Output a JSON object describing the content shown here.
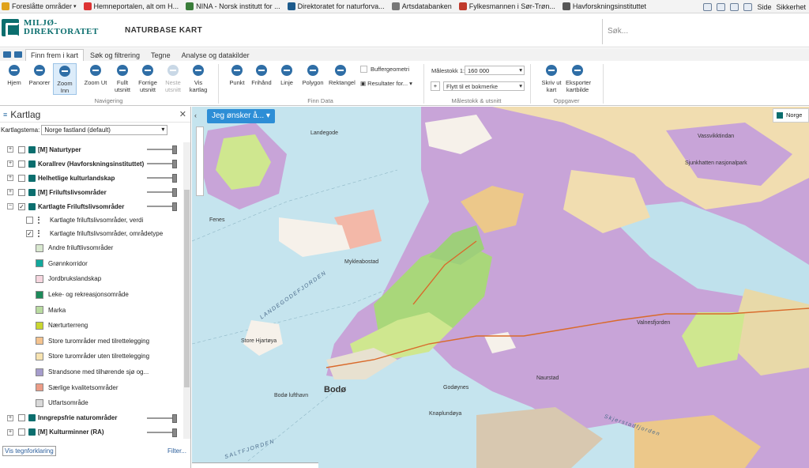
{
  "favorites": [
    {
      "label": "Foreslåtte områder",
      "color": "#e0a21b",
      "dropdown": true
    },
    {
      "label": "Hemneportalen, alt om H...",
      "color": "#d33",
      "dropdown": false
    },
    {
      "label": "NINA - Norsk institutt for ...",
      "color": "#3a7d3a",
      "dropdown": false
    },
    {
      "label": "Direktoratet for naturforva...",
      "color": "#1d5b8c",
      "dropdown": false
    },
    {
      "label": "Artsdatabanken",
      "color": "#777",
      "dropdown": false
    },
    {
      "label": "Fylkesmannen i Sør-Trøn...",
      "color": "#c0392b",
      "dropdown": false
    },
    {
      "label": "Havforskningsinstituttet",
      "color": "#555",
      "dropdown": false
    }
  ],
  "browser_menu": {
    "side": "Side",
    "sikkerhet": "Sikkerhet"
  },
  "header": {
    "logo_line1": "MILJØ-",
    "logo_line2": "DIREKTORATET",
    "app_title": "NATURBASE KART",
    "search_placeholder": "Søk..."
  },
  "tabs": [
    "Finn frem i kart",
    "Søk og filtrering",
    "Tegne",
    "Analyse og datakilder"
  ],
  "ribbon": {
    "navigation": [
      {
        "label": "Hjem",
        "icon": "home-icon",
        "enabled": true
      },
      {
        "label": "Panorer",
        "icon": "pan-icon",
        "enabled": true
      },
      {
        "label": "Zoom Inn",
        "icon": "zoom-in-icon",
        "enabled": true,
        "selected": true
      },
      {
        "label": "Zoom Ut",
        "icon": "zoom-out-icon",
        "enabled": true
      },
      {
        "label": "Fullt utsnitt",
        "icon": "full-extent-icon",
        "enabled": true
      },
      {
        "label": "Forrige utsnitt",
        "icon": "previous-extent-icon",
        "enabled": true
      },
      {
        "label": "Neste utsnitt",
        "icon": "next-extent-icon",
        "enabled": false
      },
      {
        "label": "Vis kartlag",
        "icon": "layers-icon",
        "enabled": true
      }
    ],
    "navigation_group": "Navigering",
    "find": [
      {
        "label": "Punkt",
        "icon": "point-icon"
      },
      {
        "label": "Frihånd",
        "icon": "freehand-icon"
      },
      {
        "label": "Linje",
        "icon": "line-icon"
      },
      {
        "label": "Polygon",
        "icon": "polygon-icon"
      },
      {
        "label": "Rektangel",
        "icon": "rectangle-icon"
      }
    ],
    "buffer_label": "Buffergeometri",
    "results_label": "Resultater for...",
    "find_group": "Finn Data",
    "scale_label": "Målestokk 1:",
    "scale_value": "160 000",
    "bookmark_placeholder": "Flytt til et bokmerke",
    "scale_group": "Målestokk & utsnitt",
    "tasks": [
      {
        "label": "Skriv ut kart",
        "icon": "print-icon"
      },
      {
        "label": "Eksporter kartbilde",
        "icon": "export-icon"
      }
    ],
    "tasks_group": "Oppgaver"
  },
  "sidebar": {
    "title": "Kartlag",
    "theme_label": "Kartlagstema:",
    "theme_value": "Norge fastland (default)",
    "layers_top": [
      {
        "label": "[M] Naturtyper",
        "checked": false,
        "expand": "+"
      },
      {
        "label": "Korallrev (Havforskningsinstituttet)",
        "checked": false,
        "expand": "+"
      },
      {
        "label": "Helhetlige kulturlandskap",
        "checked": false,
        "expand": "+"
      },
      {
        "label": "[M] Friluftslivsområder",
        "checked": false,
        "expand": "+"
      },
      {
        "label": "Kartlagte Friluftslivsområder",
        "checked": true,
        "expand": "−"
      }
    ],
    "sublayers": [
      {
        "label": "Kartlagte friluftslivsområder, verdi",
        "checked": false
      },
      {
        "label": "Kartlagte friluftslivsområder, områdetype",
        "checked": true
      }
    ],
    "legend": [
      {
        "label": "Andre friluftlivsområder",
        "color": "#d8e8cf"
      },
      {
        "label": "Grønnkorridor",
        "color": "#12a89c"
      },
      {
        "label": "Jordbrukslandskap",
        "color": "#f6d6df"
      },
      {
        "label": "Leke- og rekreasjonsområde",
        "color": "#1d8a5a"
      },
      {
        "label": "Marka",
        "color": "#b9dba0"
      },
      {
        "label": "Nærturterreng",
        "color": "#c9d630"
      },
      {
        "label": "Store turområder med tilrettelegging",
        "color": "#f4c38f"
      },
      {
        "label": "Store turområder uten tilrettelegging",
        "color": "#f7e3b0"
      },
      {
        "label": "Strandsone med tilhørende sjø og...",
        "color": "#a59ccc"
      },
      {
        "label": "Særlige kvalitetsområder",
        "color": "#ec9c86"
      },
      {
        "label": "Utfartsområde",
        "color": "#d9d9d9"
      }
    ],
    "layers_bottom": [
      {
        "label": "Inngrepsfrie naturområder",
        "checked": false,
        "expand": "+"
      },
      {
        "label": "[M] Kulturminner (RA)",
        "checked": false,
        "expand": "+"
      }
    ],
    "legend_button": "Vis tegnforklaring",
    "filter_link": "Filter..."
  },
  "map": {
    "action_button": "Jeg ønsker å...",
    "basemap_label": "Norge",
    "places": [
      {
        "name": "Landegode"
      },
      {
        "name": "Fenes"
      },
      {
        "name": "Bodø",
        "big": true
      },
      {
        "name": "Bodø lufthavn"
      },
      {
        "name": "Store Hjartøya"
      },
      {
        "name": "Mykleabostad"
      },
      {
        "name": "Valnesfjorden"
      },
      {
        "name": "Naurstad"
      },
      {
        "name": "Godøynes"
      },
      {
        "name": "Sjunkhatten nasjonalpark"
      },
      {
        "name": "Vassvikktindan"
      },
      {
        "name": "Knaplundøya"
      }
    ],
    "water_labels": [
      "LANDEGODEFJORDEN",
      "SALTFJORDEN",
      "Skjerstadfjorden"
    ]
  }
}
